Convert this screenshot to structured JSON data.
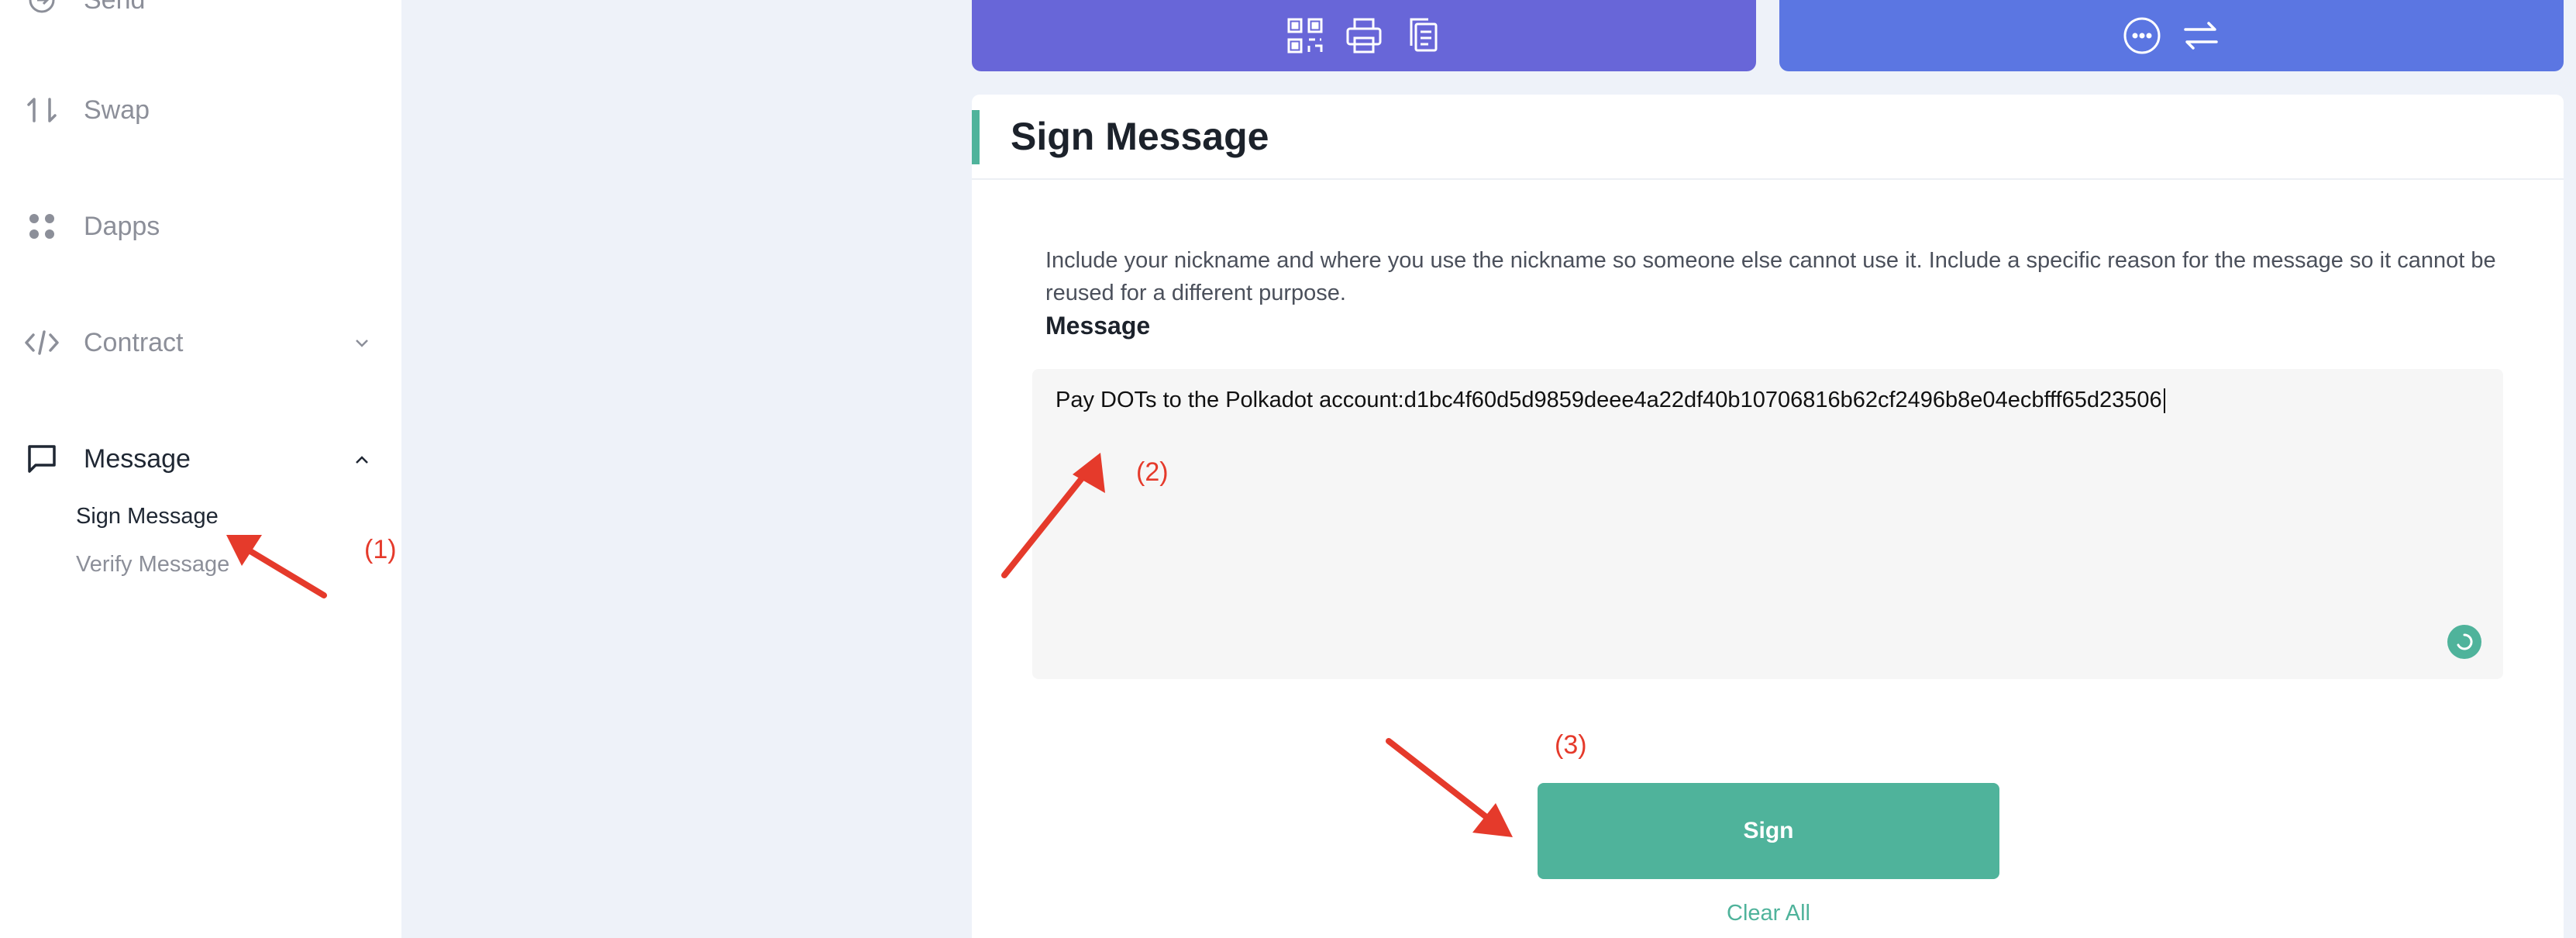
{
  "sidebar": {
    "items": [
      {
        "label": "Send",
        "icon": "send-icon"
      },
      {
        "label": "Swap",
        "icon": "swap-icon"
      },
      {
        "label": "Dapps",
        "icon": "dapps-icon"
      },
      {
        "label": "Contract",
        "icon": "code-icon"
      },
      {
        "label": "Message",
        "icon": "message-icon"
      }
    ],
    "sub_items": [
      {
        "label": "Sign Message",
        "active": true
      },
      {
        "label": "Verify Message",
        "active": false
      }
    ]
  },
  "top_cards": {
    "left_icons": [
      "qr-code-icon",
      "printer-icon",
      "copy-icon"
    ],
    "right_icons": [
      "more-icon",
      "transfer-icon"
    ]
  },
  "main": {
    "title": "Sign Message",
    "hint": "Include your nickname and where you use the nickname so someone else cannot use it. Include a specific reason for the message so it cannot be reused for a different purpose.",
    "message_label": "Message",
    "message_value": "Pay DOTs to the Polkadot account:d1bc4f60d5d9859deee4a22df40b10706816b62cf2496b8e04ecbfff65d23506",
    "sign_label": "Sign",
    "clear_label": "Clear All"
  },
  "annotations": [
    "(1)",
    "(2)",
    "(3)"
  ],
  "colors": {
    "accent": "#4fb39b",
    "annotation": "#e53a2b",
    "card_left": "#6866d8",
    "card_right": "#5b76e2",
    "background": "#eef2f9"
  }
}
